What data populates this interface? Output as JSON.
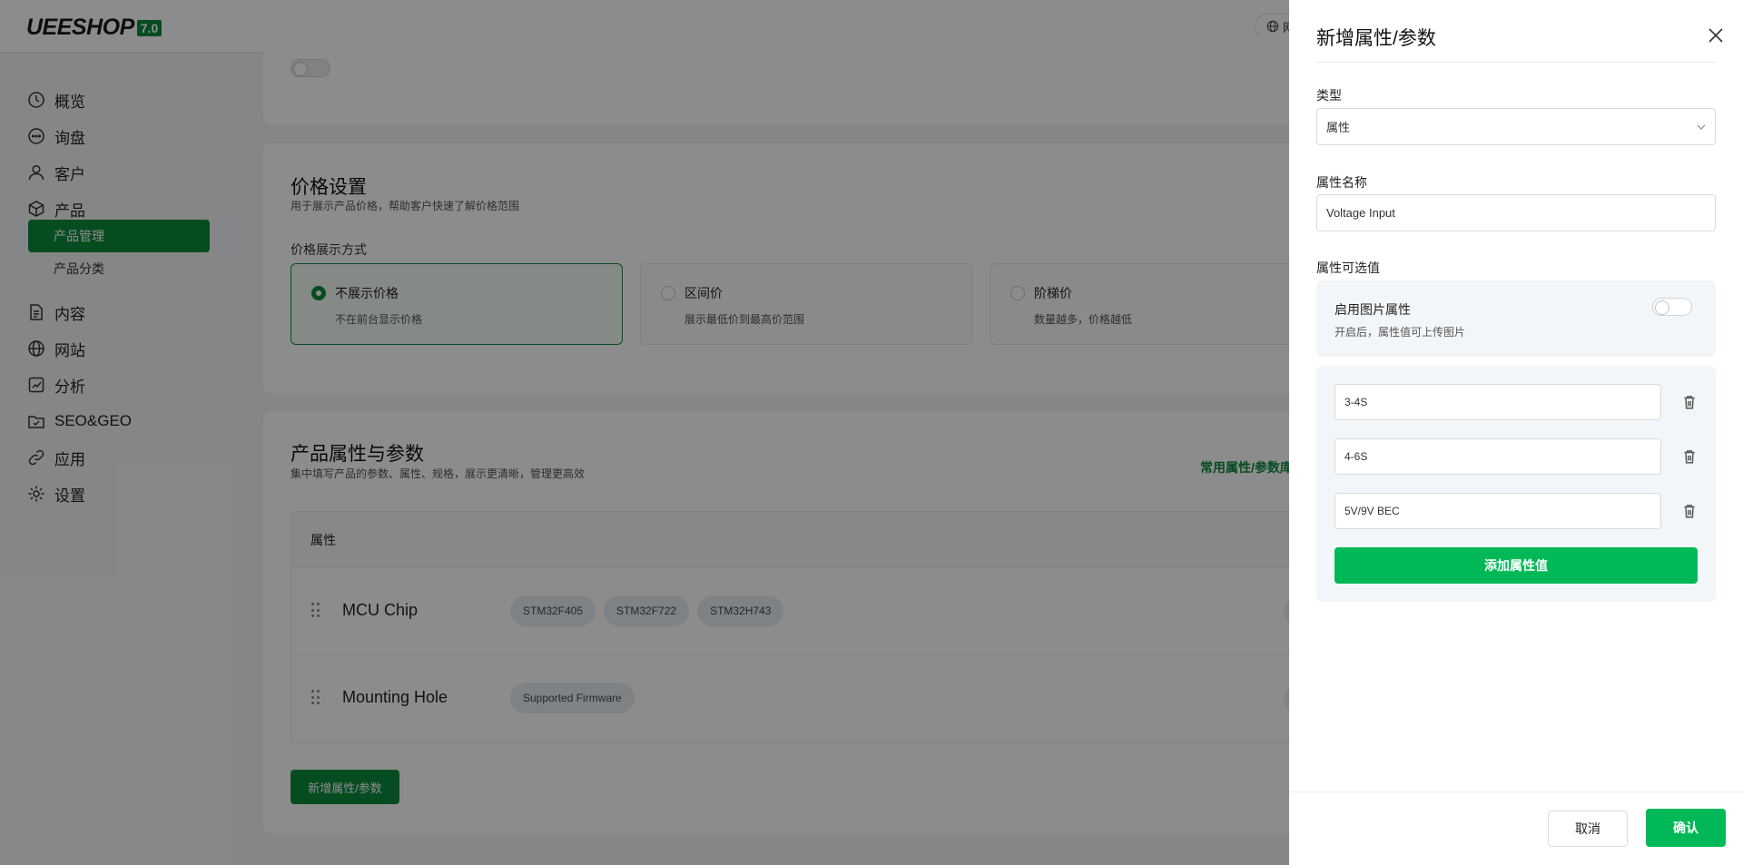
{
  "header": {
    "logo_text": "UEESHOP",
    "logo_version": "7.0",
    "lang_label": "网"
  },
  "sidebar": {
    "items": [
      {
        "label": "概览",
        "icon": "clock-icon"
      },
      {
        "label": "询盘",
        "icon": "chat-icon"
      },
      {
        "label": "客户",
        "icon": "user-icon"
      },
      {
        "label": "产品",
        "icon": "box-icon"
      },
      {
        "label": "内容",
        "icon": "document-icon"
      },
      {
        "label": "网站",
        "icon": "globe-icon"
      },
      {
        "label": "分析",
        "icon": "chart-icon"
      },
      {
        "label": "SEO&GEO",
        "icon": "folder-icon"
      },
      {
        "label": "应用",
        "icon": "link-icon"
      },
      {
        "label": "设置",
        "icon": "gear-icon"
      }
    ],
    "sub_items": [
      {
        "label": "产品管理",
        "active": true
      },
      {
        "label": "产品分类",
        "active": false
      }
    ]
  },
  "price_settings": {
    "title": "价格设置",
    "description": "用于展示产品价格，帮助客户快速了解价格范围",
    "display_label": "价格展示方式",
    "options": [
      {
        "title": "不展示价格",
        "desc": "不在前台显示价格",
        "selected": true
      },
      {
        "title": "区间价",
        "desc": "展示最低价到最高价范围",
        "selected": false
      },
      {
        "title": "阶梯价",
        "desc": "数量越多，价格越低",
        "selected": false
      }
    ]
  },
  "attributes_card": {
    "title": "产品属性与参数",
    "description": "集中填写产品的参数、属性、规格，展示更清晰，管理更高效",
    "common_link": "常用属性/参数库",
    "table_header": "属性",
    "rows": [
      {
        "name": "MCU Chip",
        "tags": [
          "STM32F405",
          "STM32F722",
          "STM32H743"
        ]
      },
      {
        "name": "Mounting Hole",
        "tags": [
          "Supported Firmware"
        ]
      }
    ],
    "add_button": "新增属性/参数"
  },
  "drawer": {
    "title": "新增属性/参数",
    "type_label": "类型",
    "type_value": "属性",
    "name_label": "属性名称",
    "name_value": "Voltage Input",
    "values_label": "属性可选值",
    "image_attr_title": "启用图片属性",
    "image_attr_desc": "开启后，属性值可上传图片",
    "image_attr_enabled": false,
    "values": [
      "3-4S",
      "4-6S",
      "5V/9V BEC"
    ],
    "add_value_button": "添加属性值",
    "cancel_button": "取消",
    "confirm_button": "确认"
  },
  "colors": {
    "accent": "#0c8a3c",
    "primary_button": "#00b858",
    "overlay": "rgba(0,0,0,0.45)"
  }
}
